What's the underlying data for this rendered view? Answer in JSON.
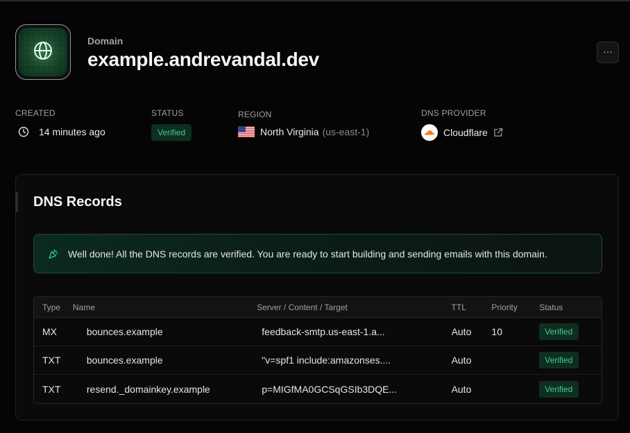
{
  "header": {
    "label": "Domain",
    "title": "example.andrevandal.dev",
    "more_label": "···"
  },
  "meta": {
    "created": {
      "label": "CREATED",
      "value": "14 minutes ago"
    },
    "status": {
      "label": "STATUS",
      "value": "Verified"
    },
    "region": {
      "label": "REGION",
      "value": "North Virginia",
      "code": "(us-east-1)"
    },
    "dns_provider": {
      "label": "DNS PROVIDER",
      "value": "Cloudflare"
    }
  },
  "dns": {
    "title": "DNS Records",
    "banner": "Well done! All the DNS records are verified. You are ready to start building and sending emails with this domain.",
    "columns": [
      "Type",
      "Name",
      "Server / Content / Target",
      "TTL",
      "Priority",
      "Status"
    ],
    "rows": [
      {
        "type": "MX",
        "name": "bounces.example",
        "server": "feedback-smtp.us-east-1.a...",
        "ttl": "Auto",
        "priority": "10",
        "status": "Verified"
      },
      {
        "type": "TXT",
        "name": "bounces.example",
        "server": "\"v=spf1 include:amazonses....",
        "ttl": "Auto",
        "priority": "",
        "status": "Verified"
      },
      {
        "type": "TXT",
        "name": "resend._domainkey.example",
        "server": "p=MIGfMA0GCSqGSIb3DQE...",
        "ttl": "Auto",
        "priority": "",
        "status": "Verified"
      }
    ]
  },
  "colors": {
    "background": "#050506",
    "success": "#3fcf8e",
    "badge_bg": "#0f2e21",
    "cloudflare": "#f38020"
  },
  "icons": [
    "globe-icon",
    "clock-icon",
    "us-flag-icon",
    "cloudflare-icon",
    "external-link-icon",
    "party-popper-icon"
  ]
}
